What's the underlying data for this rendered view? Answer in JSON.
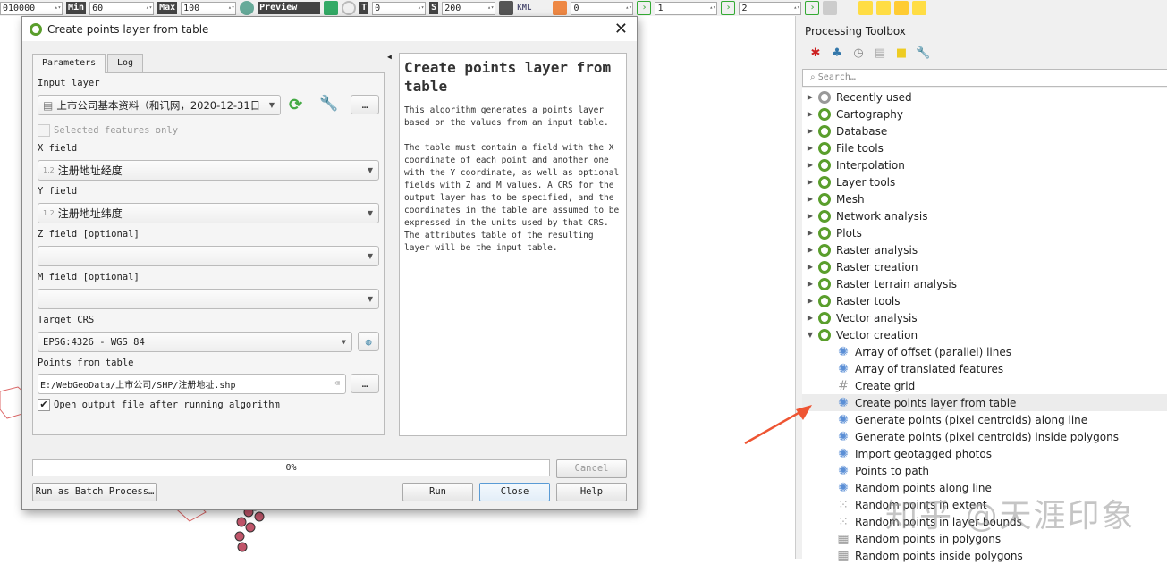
{
  "toolbar": {
    "scale": "010000",
    "min_label": "Min",
    "min": "60",
    "max_label": "Max",
    "max": "100",
    "preview": "Preview",
    "t_label": "T",
    "t": "0",
    "s_label": "S",
    "s": "200",
    "kml": "KML",
    "f1": "0",
    "f2": "1",
    "f3": "2"
  },
  "dialog": {
    "title": "Create points layer from table",
    "tabs": [
      "Parameters",
      "Log"
    ],
    "input_layer_label": "Input layer",
    "input_layer": "上市公司基本资料（和讯网，2020-12-31日",
    "selected_only": "Selected features only",
    "x_label": "X field",
    "x_value": "注册地址经度",
    "num_prefix": "1.2",
    "y_label": "Y field",
    "y_value": "注册地址纬度",
    "z_label": "Z field [optional]",
    "z_value": "",
    "m_label": "M field [optional]",
    "m_value": "",
    "crs_label": "Target CRS",
    "crs_value": "EPSG:4326 - WGS 84",
    "out_label": "Points from table",
    "out_value": "E:/WebGeoData/上市公司/SHP/注册地址.shp",
    "open_output": "Open output file after running algorithm",
    "ellipsis": "…",
    "help_title": "Create points layer from table",
    "help_p1": "This algorithm generates a points layer based on the values from an input table.",
    "help_p2": "The table must contain a field with the X coordinate of each point and another one with the Y coordinate, as well as optional fields with Z and M values. A CRS for the output layer has to be specified, and the coordinates in the table are assumed to be expressed in the units used by that CRS. The attributes table of the resulting layer will be the input table.",
    "progress": "0%",
    "progress_value": 0,
    "cancel": "Cancel",
    "batch": "Run as Batch Process…",
    "run": "Run",
    "close": "Close",
    "help": "Help"
  },
  "toolbox": {
    "title": "Processing Toolbox",
    "search_placeholder": "Search…",
    "groups": [
      "Recently used",
      "Cartography",
      "Database",
      "File tools",
      "Interpolation",
      "Layer tools",
      "Mesh",
      "Network analysis",
      "Plots",
      "Raster analysis",
      "Raster creation",
      "Raster terrain analysis",
      "Raster tools",
      "Vector analysis",
      "Vector creation"
    ],
    "items": [
      "Array of offset (parallel) lines",
      "Array of translated features",
      "Create grid",
      "Create points layer from table",
      "Generate points (pixel centroids) along line",
      "Generate points (pixel centroids) inside polygons",
      "Import geotagged photos",
      "Points to path",
      "Random points along line",
      "Random points in extent",
      "Random points in layer bounds",
      "Random points in polygons",
      "Random points inside polygons"
    ],
    "selected": "Create points layer from table"
  },
  "watermark": "知乎 @天涯印象"
}
